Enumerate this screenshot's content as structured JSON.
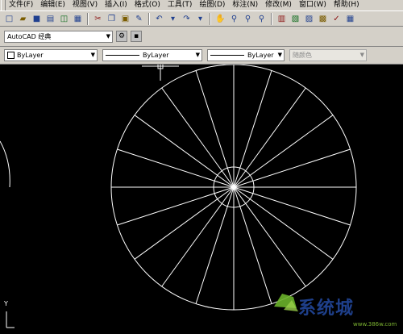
{
  "menubar": {
    "items": [
      {
        "label": "文件(F)"
      },
      {
        "label": "编辑(E)"
      },
      {
        "label": "视图(V)"
      },
      {
        "label": "插入(I)"
      },
      {
        "label": "格式(O)"
      },
      {
        "label": "工具(T)"
      },
      {
        "label": "绘图(D)"
      },
      {
        "label": "标注(N)"
      },
      {
        "label": "修改(M)"
      },
      {
        "label": "窗口(W)"
      },
      {
        "label": "帮助(H)"
      }
    ]
  },
  "toolbar": {
    "icons": [
      "new-icon",
      "open-icon",
      "save-icon",
      "print-icon",
      "plot-preview-icon",
      "publish-icon",
      "cut-icon",
      "copy-icon",
      "paste-icon",
      "match-properties-icon",
      "undo-icon",
      "redo-icon",
      "pan-icon",
      "zoom-realtime-icon",
      "zoom-window-icon",
      "zoom-previous-icon",
      "properties-icon",
      "design-center-icon",
      "tool-palettes-icon",
      "sheet-set-icon",
      "markup-icon",
      "calculator-icon"
    ]
  },
  "workspace": {
    "selected": "AutoCAD 经典"
  },
  "properties": {
    "color": "ByLayer",
    "linetype": "ByLayer",
    "lineweight": "ByLayer",
    "plotstyle": "随颜色"
  },
  "canvas": {
    "ucs_label": "Y",
    "line_color": "#ffffff",
    "background": "#000000"
  },
  "watermark": {
    "text": "系统城",
    "url": "www.386w.com"
  }
}
